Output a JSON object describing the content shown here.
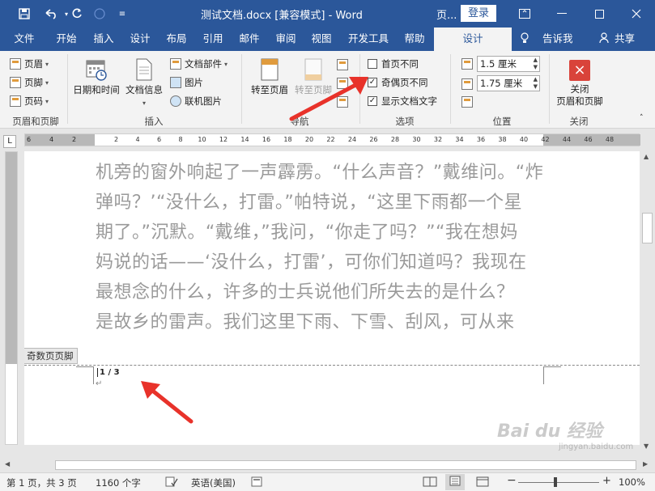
{
  "titlebar": {
    "title": "测试文档.docx [兼容模式]  -  Word",
    "context_tab": "页...",
    "login": "登录",
    "bg_color": "#2b579a"
  },
  "menu": {
    "items": [
      "文件",
      "开始",
      "插入",
      "设计",
      "布局",
      "引用",
      "邮件",
      "审阅",
      "视图",
      "开发工具",
      "帮助",
      "设计"
    ],
    "active_index": 11,
    "tell_me": "告诉我",
    "share": "共享"
  },
  "ribbon": {
    "hf_group": {
      "header": "页眉",
      "footer": "页脚",
      "page_number": "页码",
      "label": "页眉和页脚"
    },
    "insert_group": {
      "datetime": "日期和时间",
      "docinfo": "文档信息",
      "docparts": "文档部件",
      "picture": "图片",
      "online_picture": "联机图片",
      "label": "插入"
    },
    "nav_group": {
      "goto_header": "转至页眉",
      "goto_footer": "转至页脚",
      "label": "导航"
    },
    "options_group": {
      "diff_first": "首页不同",
      "diff_odd_even": "奇偶页不同",
      "show_text": "显示文档文字",
      "diff_first_checked": false,
      "diff_odd_even_checked": true,
      "show_text_checked": true,
      "label": "选项"
    },
    "position_group": {
      "header_pos": "1.5 厘米",
      "footer_pos": "1.75 厘米",
      "label": "位置"
    },
    "close_group": {
      "close_label_1": "关闭",
      "close_label_2": "页眉和页脚",
      "label": "关闭"
    }
  },
  "ruler": {
    "corner": "L",
    "left_nums": [
      "6",
      "4",
      "2"
    ],
    "nums": [
      "2",
      "4",
      "6",
      "8",
      "10",
      "12",
      "14",
      "16",
      "18",
      "20",
      "22",
      "24",
      "26",
      "28",
      "30",
      "32",
      "34",
      "36",
      "38",
      "40",
      "42",
      "44",
      "46",
      "48"
    ]
  },
  "document": {
    "lines": [
      "机旁的窗外响起了一声霹雳。“什么声音？”戴维问。“炸",
      "弹吗？’“没什么，打雷。”帕特说，“这里下雨都一个星",
      "期了。”沉默。“戴维，”我问，“你走了吗？”“我在想妈",
      "妈说的话——‘没什么，打雷’，可你们知道吗？我现在",
      "最想念的什么，许多的士兵说他们所失去的是什么？",
      "是故乡的雷声。我们这里下雨、下雪、刮风，可从来"
    ],
    "footer_tag": "奇数页页脚",
    "page_number": "1 / 3"
  },
  "statusbar": {
    "page": "第 1 页，共 3 页",
    "words": "1160 个字",
    "language": "英语(美国)",
    "zoom": "100%",
    "zoom_minus": "−",
    "zoom_plus": "+"
  },
  "watermark": {
    "main": "Bai du 经验",
    "sub": "jingyan.baidu.com"
  },
  "colors": {
    "accent": "#2b579a",
    "arrow": "#e8322a",
    "close_icon": "#d9433a"
  }
}
